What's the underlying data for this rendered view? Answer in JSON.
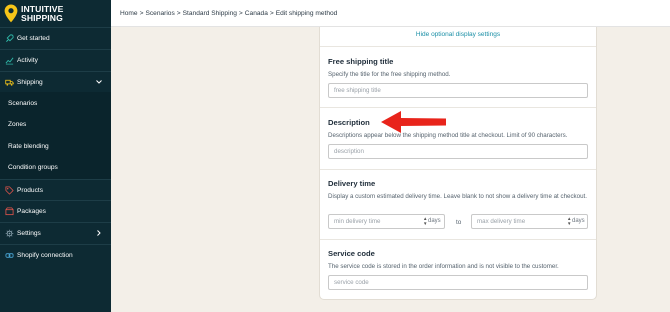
{
  "brand": {
    "line1": "INTUITIVE",
    "line2": "SHIPPING"
  },
  "breadcrumb": [
    "Home",
    "Scenarios",
    "Standard Shipping",
    "Canada",
    "Edit shipping method"
  ],
  "breadcrumb_sep": ">",
  "sidebar": {
    "items": [
      {
        "label": "Get started",
        "icon": "rocket-icon"
      },
      {
        "label": "Activity",
        "icon": "chart-icon"
      },
      {
        "label": "Shipping",
        "icon": "truck-icon"
      },
      {
        "label": "Scenarios"
      },
      {
        "label": "Zones"
      },
      {
        "label": "Rate blending"
      },
      {
        "label": "Condition groups"
      },
      {
        "label": "Products",
        "icon": "tag-icon"
      },
      {
        "label": "Packages",
        "icon": "package-icon"
      },
      {
        "label": "Settings",
        "icon": "gear-icon"
      },
      {
        "label": "Shopify connection",
        "icon": "link-icon"
      }
    ]
  },
  "form": {
    "hide_link": "Hide optional display settings",
    "free_shipping": {
      "title": "Free shipping title",
      "desc": "Specify the title for the free shipping method.",
      "placeholder": "free shipping title"
    },
    "description": {
      "title": "Description",
      "desc": "Descriptions appear below the shipping method title at checkout. Limit of 90 characters.",
      "placeholder": "description"
    },
    "delivery_time": {
      "title": "Delivery time",
      "desc": "Display a custom estimated delivery time. Leave blank to not show a delivery time at checkout.",
      "min_placeholder": "min delivery time",
      "max_placeholder": "max delivery time",
      "unit": "days",
      "to": "to"
    },
    "service_code": {
      "title": "Service code",
      "desc": "The service code is stored in the order information and is not visible to the customer.",
      "placeholder": "service code"
    }
  },
  "colors": {
    "sidebar": "#0d2a33",
    "accent": "#1a8fa6",
    "brand_yellow": "#f5c518",
    "arrow": "#e8241b"
  }
}
